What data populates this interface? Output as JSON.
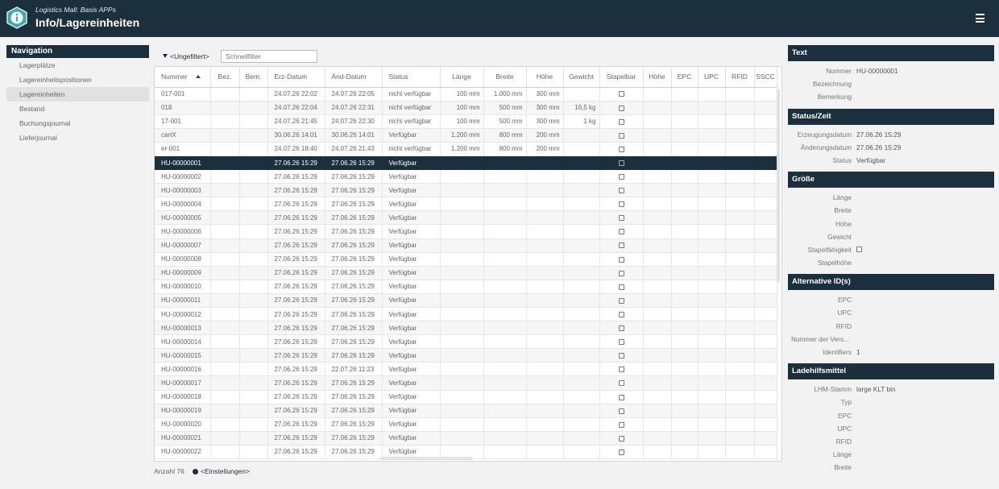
{
  "header": {
    "subtitle": "Logistics Mall: Basis APPs",
    "title": "Info/Lagereinheiten",
    "icons": {
      "logo": "info-icon",
      "menu": "hamburger-menu-icon"
    }
  },
  "nav": {
    "heading": "Navigation",
    "items": [
      {
        "label": "Lagerplätze",
        "active": false
      },
      {
        "label": "Lagereinheitspositionen",
        "active": false
      },
      {
        "label": "Lagereinheiten",
        "active": true
      },
      {
        "label": "Bestand",
        "active": false
      },
      {
        "label": "Buchungsjournal",
        "active": false
      },
      {
        "label": "Lieferjournal",
        "active": false
      }
    ]
  },
  "filter": {
    "label": "<Ungefiltert>",
    "placeholder": "Schnellfilter",
    "icon": "filter-icon"
  },
  "table": {
    "columns": [
      "Nummer",
      "Bez.",
      "Bem.",
      "Erz-Datum",
      "Änd-Datum",
      "Status",
      "Länge",
      "Breite",
      "Höhe",
      "Gewicht",
      "Stapelbar",
      "Höhe",
      "EPC",
      "UPC",
      "RFID",
      "SSCC"
    ],
    "sort_icon": "sort-ascending-icon",
    "selected_row": 5,
    "rows": [
      [
        "017-001",
        "",
        "",
        "24.07.26 22:02",
        "24.07.26 22:05",
        "nicht verfügbar",
        "100 mm",
        "1.000 mm",
        "300 mm",
        "",
        ""
      ],
      [
        "018",
        "",
        "",
        "24.07.26 22:04",
        "24.07.26 22:31",
        "nicht verfügbar",
        "100 mm",
        "500 mm",
        "300 mm",
        "16,5 kg",
        ""
      ],
      [
        "17-001",
        "",
        "",
        "24.07.26 21:45",
        "24.07.26 22:30",
        "nicht verfügbar",
        "100 mm",
        "500 mm",
        "300 mm",
        "1 kg",
        ""
      ],
      [
        "cartX",
        "",
        "",
        "30.06.26 14:01",
        "30.06.26 14:01",
        "Verfügbar",
        "1.200 mm",
        "800 mm",
        "200 mm",
        "",
        ""
      ],
      [
        "er-001",
        "",
        "",
        "24.07.26 18:40",
        "24.07.26 21:43",
        "nicht verfügbar",
        "1.200 mm",
        "800 mm",
        "200 mm",
        "",
        ""
      ],
      [
        "HU-00000001",
        "",
        "",
        "27.06.26 15:29",
        "27.06.26 15:29",
        "Verfügbar",
        "",
        "",
        "",
        "",
        ""
      ],
      [
        "HU-00000002",
        "",
        "",
        "27.06.26 15:29",
        "27.06.26 15:29",
        "Verfügbar",
        "",
        "",
        "",
        "",
        ""
      ],
      [
        "HU-00000003",
        "",
        "",
        "27.06.26 15:29",
        "27.06.26 15:29",
        "Verfügbar",
        "",
        "",
        "",
        "",
        ""
      ],
      [
        "HU-00000004",
        "",
        "",
        "27.06.26 15:29",
        "27.06.26 15:29",
        "Verfügbar",
        "",
        "",
        "",
        "",
        ""
      ],
      [
        "HU-00000005",
        "",
        "",
        "27.06.26 15:29",
        "27.06.26 15:29",
        "Verfügbar",
        "",
        "",
        "",
        "",
        ""
      ],
      [
        "HU-00000006",
        "",
        "",
        "27.06.26 15:29",
        "27.06.26 15:29",
        "Verfügbar",
        "",
        "",
        "",
        "",
        ""
      ],
      [
        "HU-00000007",
        "",
        "",
        "27.06.26 15:29",
        "27.06.26 15:29",
        "Verfügbar",
        "",
        "",
        "",
        "",
        ""
      ],
      [
        "HU-00000008",
        "",
        "",
        "27.06.26 15:29",
        "27.06.26 15:29",
        "Verfügbar",
        "",
        "",
        "",
        "",
        ""
      ],
      [
        "HU-00000009",
        "",
        "",
        "27.06.26 15:29",
        "27.06.26 15:29",
        "Verfügbar",
        "",
        "",
        "",
        "",
        ""
      ],
      [
        "HU-00000010",
        "",
        "",
        "27.06.26 15:29",
        "27.06.26 15:29",
        "Verfügbar",
        "",
        "",
        "",
        "",
        ""
      ],
      [
        "HU-00000011",
        "",
        "",
        "27.06.26 15:29",
        "27.06.26 15:29",
        "Verfügbar",
        "",
        "",
        "",
        "",
        ""
      ],
      [
        "HU-00000012",
        "",
        "",
        "27.06.26 15:29",
        "27.06.26 15:29",
        "Verfügbar",
        "",
        "",
        "",
        "",
        ""
      ],
      [
        "HU-00000013",
        "",
        "",
        "27.06.26 15:29",
        "27.06.26 15:29",
        "Verfügbar",
        "",
        "",
        "",
        "",
        ""
      ],
      [
        "HU-00000014",
        "",
        "",
        "27.06.26 15:29",
        "27.06.26 15:29",
        "Verfügbar",
        "",
        "",
        "",
        "",
        ""
      ],
      [
        "HU-00000015",
        "",
        "",
        "27.06.26 15:29",
        "27.06.26 15:29",
        "Verfügbar",
        "",
        "",
        "",
        "",
        ""
      ],
      [
        "HU-00000016",
        "",
        "",
        "27.06.26 15:29",
        "22.07.26 11:23",
        "Verfügbar",
        "",
        "",
        "",
        "",
        ""
      ],
      [
        "HU-00000017",
        "",
        "",
        "27.06.26 15:29",
        "27.06.26 15:29",
        "Verfügbar",
        "",
        "",
        "",
        "",
        ""
      ],
      [
        "HU-00000018",
        "",
        "",
        "27.06.26 15:29",
        "27.06.26 15:29",
        "Verfügbar",
        "",
        "",
        "",
        "",
        ""
      ],
      [
        "HU-00000019",
        "",
        "",
        "27.06.26 15:29",
        "27.06.26 15:29",
        "Verfügbar",
        "",
        "",
        "",
        "",
        ""
      ],
      [
        "HU-00000020",
        "",
        "",
        "27.06.26 15:29",
        "27.06.26 15:29",
        "Verfügbar",
        "",
        "",
        "",
        "",
        ""
      ],
      [
        "HU-00000021",
        "",
        "",
        "27.06.26 15:29",
        "27.06.26 15:29",
        "Verfügbar",
        "",
        "",
        "",
        "",
        ""
      ],
      [
        "HU-00000022",
        "",
        "",
        "27.06.26 15:29",
        "27.06.26 15:29",
        "Verfügbar",
        "",
        "",
        "",
        "",
        ""
      ]
    ]
  },
  "footer": {
    "count_label": "Anzahl 76",
    "settings_label": "<Einstellungen>",
    "settings_icon": "gear-icon"
  },
  "detail": {
    "sections": [
      {
        "title": "Text",
        "fields": [
          {
            "label": "Nummer",
            "value": "HU-00000001"
          },
          {
            "label": "Bezeichnung",
            "value": ""
          },
          {
            "label": "Bemerkung",
            "value": ""
          }
        ]
      },
      {
        "title": "Status/Zeit",
        "fields": [
          {
            "label": "Erzeugungsdatum",
            "value": "27.06.26 15:29"
          },
          {
            "label": "Änderungsdatum",
            "value": "27.06.26 15:29"
          },
          {
            "label": "Status",
            "value": "Verfügbar"
          }
        ]
      },
      {
        "title": "Größe",
        "fields": [
          {
            "label": "Länge",
            "value": ""
          },
          {
            "label": "Breite",
            "value": ""
          },
          {
            "label": "Höhe",
            "value": ""
          },
          {
            "label": "Gewicht",
            "value": ""
          },
          {
            "label": "Stapelfähigkeit",
            "value": "",
            "checkbox": true
          },
          {
            "label": "Stapelhöhe",
            "value": ""
          }
        ]
      },
      {
        "title": "Alternative ID(s)",
        "fields": [
          {
            "label": "EPC",
            "value": ""
          },
          {
            "label": "UPC",
            "value": ""
          },
          {
            "label": "RFID",
            "value": ""
          },
          {
            "label": "Nummer der Vers...",
            "value": "",
            "clip": true
          },
          {
            "label": "Identifiers",
            "value": "1"
          }
        ]
      },
      {
        "title": "Ladehilfsmittel",
        "fields": [
          {
            "label": "LHM-Stamm",
            "value": "large KLT bin"
          },
          {
            "label": "Typ",
            "value": ""
          },
          {
            "label": "EPC",
            "value": ""
          },
          {
            "label": "UPC",
            "value": ""
          },
          {
            "label": "RFID",
            "value": ""
          },
          {
            "label": "Länge",
            "value": ""
          },
          {
            "label": "Breite",
            "value": ""
          }
        ]
      }
    ]
  }
}
